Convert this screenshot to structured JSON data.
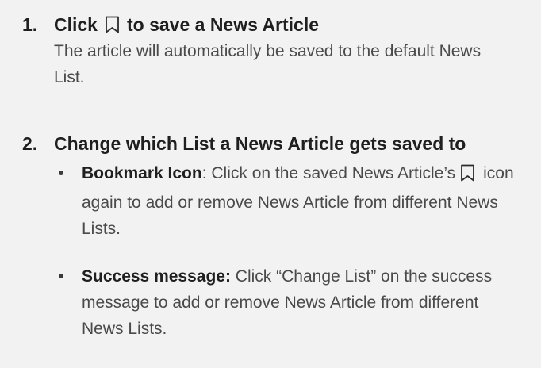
{
  "step1": {
    "number": "1.",
    "heading_before": "Click",
    "icon": "bookmark-icon",
    "heading_after": "to save a News Article",
    "body": "The article will automatically be saved to the default News List."
  },
  "step2": {
    "number": "2.",
    "heading": "Change which List a News Article gets saved to",
    "bullets": [
      {
        "term": "Bookmark Icon",
        "text_before": ": Click on the saved News Article’s",
        "icon": "bookmark-icon",
        "text_after": "icon again to add or remove News Article from different News Lists."
      },
      {
        "term": "Success message:",
        "text": " Click “Change List” on the success message to add or remove News Article from different News Lists."
      }
    ]
  }
}
